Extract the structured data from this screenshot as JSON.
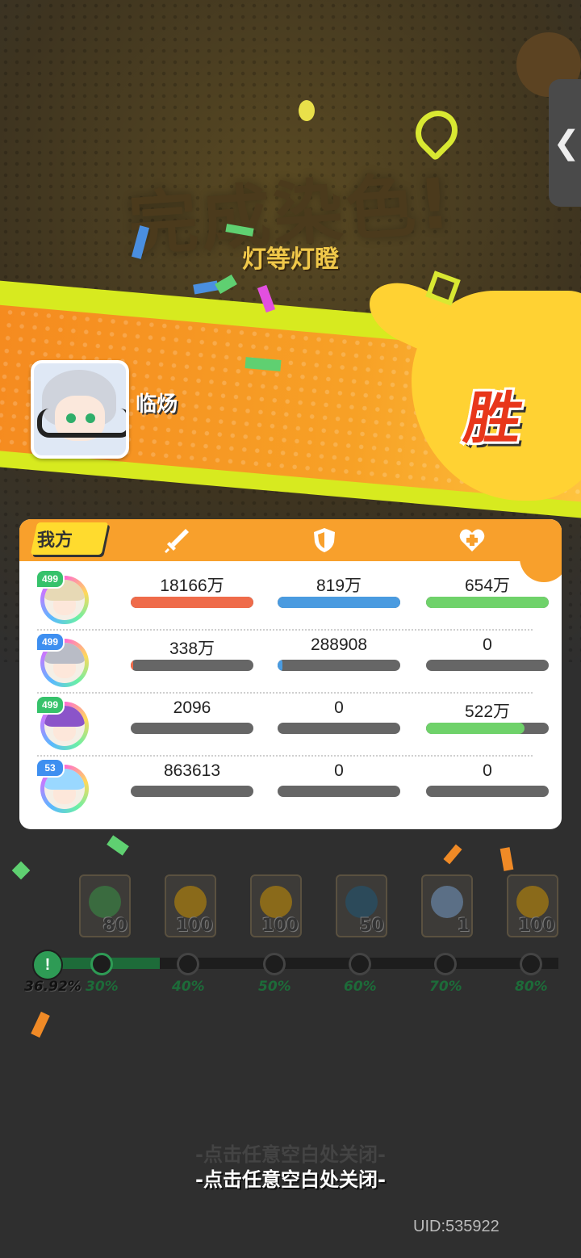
{
  "header": {
    "title": "完成染色!",
    "subtitle": "灯等灯瞪",
    "back_glyph": "❮"
  },
  "result": {
    "player_name": "临炀",
    "outcome": "胜"
  },
  "panel": {
    "team_label": "我方",
    "columns": [
      "attack-sword-icon",
      "defense-shield-icon",
      "heal-heart-icon"
    ],
    "rows": [
      {
        "level": "499",
        "level_color": "#36c26b",
        "hair": "#e7d9b5",
        "damage": "18166万",
        "damage_fill": 1.0,
        "tank": "819万",
        "tank_fill": 1.0,
        "heal": "654万",
        "heal_fill": 1.0
      },
      {
        "level": "499",
        "level_color": "#3e8ff0",
        "hair": "#b9bcc6",
        "damage": "338万",
        "damage_fill": 0.02,
        "tank": "288908",
        "tank_fill": 0.04,
        "heal": "0",
        "heal_fill": 0
      },
      {
        "level": "499",
        "level_color": "#36c26b",
        "hair": "#8b54c9",
        "damage": "2096",
        "damage_fill": 0.0,
        "tank": "0",
        "tank_fill": 0,
        "heal": "522万",
        "heal_fill": 0.8
      },
      {
        "level": "53",
        "level_color": "#3e8ff0",
        "hair": "#9ad8ff",
        "damage": "863613",
        "damage_fill": 0.0,
        "tank": "0",
        "tank_fill": 0,
        "heal": "0",
        "heal_fill": 0
      }
    ]
  },
  "rewards": [
    {
      "count": "80",
      "icon": "green-check-icon",
      "color": "#3a6b3f"
    },
    {
      "count": "100",
      "icon": "coin-icon",
      "color": "#8a6a1a"
    },
    {
      "count": "100",
      "icon": "pencil-icon",
      "color": "#8a6a1a"
    },
    {
      "count": "50",
      "icon": "gem-icon",
      "color": "#2c4a5a"
    },
    {
      "count": "1",
      "icon": "house-icon",
      "color": "#5b6f86"
    },
    {
      "count": "100",
      "icon": "coin-icon",
      "color": "#8a6a1a"
    }
  ],
  "progress": {
    "current": "36.92%",
    "current_fraction": 0.3692,
    "flag_glyph": "!",
    "milestones": [
      "30%",
      "40%",
      "50%",
      "60%",
      "70%",
      "80%"
    ]
  },
  "colors": {
    "damage": "#ef6b4a",
    "tank": "#4a9be0",
    "heal": "#6fd26a"
  },
  "footer": {
    "close_hint": "-点击任意空白处关闭-",
    "uid": "UID:535922"
  }
}
